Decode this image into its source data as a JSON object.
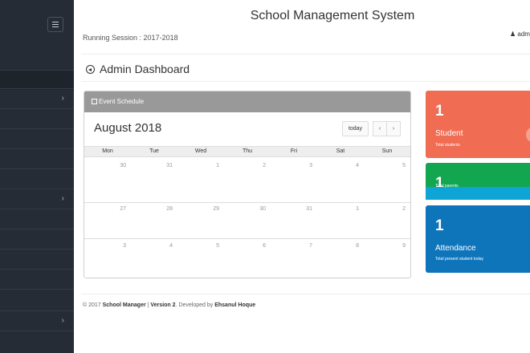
{
  "header": {
    "title": "School Management System",
    "session": "Running Session : 2017-2018",
    "user": "admin"
  },
  "dashboard": {
    "title": "Admin Dashboard"
  },
  "calendar": {
    "panel_title": "Event Schedule",
    "month": "August 2018",
    "today_label": "today",
    "prev_label": "‹",
    "next_label": "›",
    "weekdays": [
      "Mon",
      "Tue",
      "Wed",
      "Thu",
      "Fri",
      "Sat",
      "Sun"
    ],
    "weeks": [
      [
        "30",
        "31",
        "1",
        "2",
        "3",
        "4",
        "5"
      ],
      [
        "27",
        "28",
        "29",
        "30",
        "31",
        "1",
        "2"
      ],
      [
        "3",
        "4",
        "5",
        "6",
        "7",
        "8",
        "9"
      ]
    ]
  },
  "cards": {
    "student": {
      "count": "1",
      "label": "Student",
      "sub": "Total students",
      "color": "#f06c53"
    },
    "parent": {
      "count": "1",
      "sub": "Total parents",
      "color": "#12a650"
    },
    "attendance": {
      "count": "1",
      "label": "Attendance",
      "sub": "Total present student today",
      "color": "#0f75bb"
    }
  },
  "footer": {
    "prefix": "© 2017 ",
    "app": "School Manager",
    "sep": " | ",
    "version": "Version 2",
    "developed": ". Developed by ",
    "author": "Ehsanul Hoque"
  },
  "sidebar": {
    "menu_icon": "hamburger-icon",
    "chevron_icon": "chevron-right-icon"
  }
}
